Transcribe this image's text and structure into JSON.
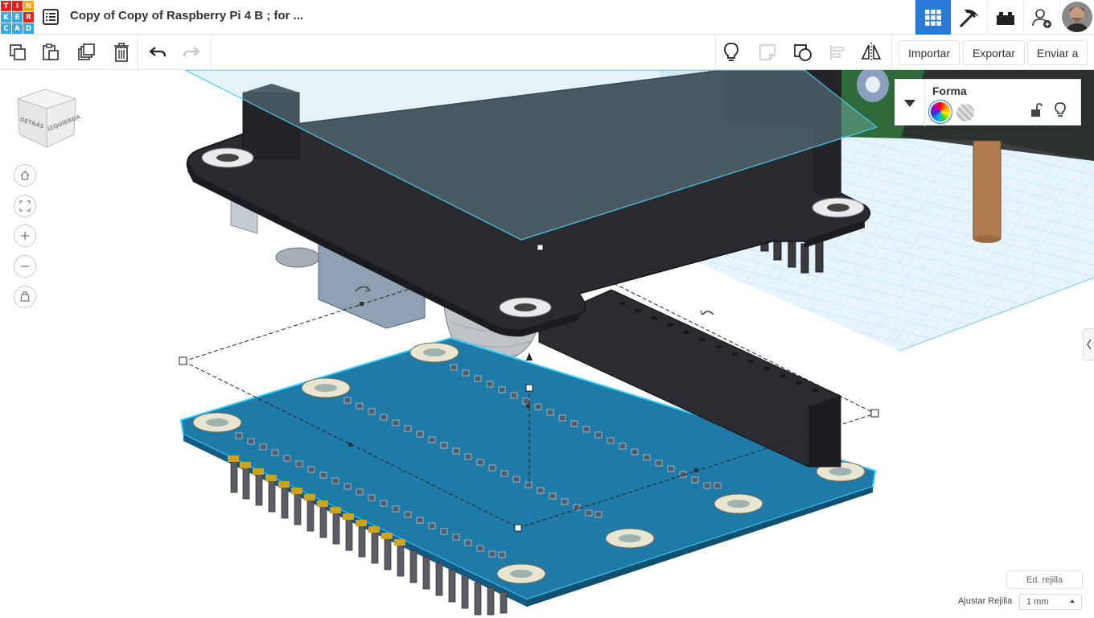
{
  "app": {
    "logo_letters": [
      "T",
      "I",
      "N",
      "K",
      "E",
      "R",
      "C",
      "A",
      "D"
    ],
    "logo_colors": [
      "#e2231a",
      "#e2231a",
      "#f7a600",
      "#36a9e0",
      "#36a9e0",
      "#e2231a",
      "#36a9e0",
      "#36a9e0",
      "#36a9e0"
    ],
    "title": "Copy of Copy of Raspberry Pi 4 B ; for ...",
    "accent": "#2a7bd5"
  },
  "header_buttons": [
    {
      "name": "3d-design-view",
      "icon": "grid-icon",
      "active": true
    },
    {
      "name": "codeblocks-view",
      "icon": "pickaxe-icon",
      "active": false
    },
    {
      "name": "bricks-view",
      "icon": "brick-icon",
      "active": false
    },
    {
      "name": "invite-user",
      "icon": "add-user-icon",
      "active": false
    }
  ],
  "toolbar": {
    "left_tools": [
      "copy-icon",
      "paste-icon",
      "duplicate-icon",
      "delete-icon",
      "undo-icon",
      "redo-icon"
    ],
    "right_tools": [
      "light-bulb-icon",
      "note-icon",
      "view-icon",
      "align-icon",
      "mirror-icon"
    ],
    "import_label": "Importar",
    "export_label": "Exportar",
    "send_label": "Enviar a"
  },
  "viewcube": {
    "face_back": "DETRÁS",
    "face_left": "IZQUIERDA"
  },
  "nav_buttons": [
    "home-icon",
    "fit-icon",
    "zoom-in-icon",
    "zoom-out-icon",
    "perspective-icon"
  ],
  "shape_panel": {
    "title": "Forma",
    "solid_color": "rainbow",
    "hole_pattern": "striped"
  },
  "grid": {
    "edit_label": "Ed. rejilla",
    "snap_label": "Ajustar Rejilla",
    "snap_value": "1 mm"
  }
}
